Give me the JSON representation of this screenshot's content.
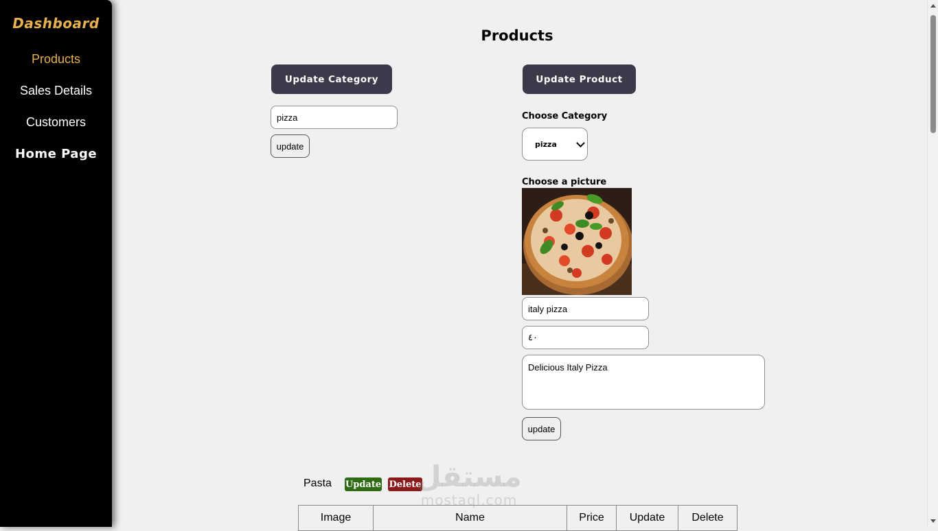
{
  "sidebar": {
    "brand": "Dashboard",
    "items": [
      {
        "label": "Products",
        "active": true
      },
      {
        "label": "Sales Details"
      },
      {
        "label": "Customers"
      },
      {
        "label": "Home Page"
      }
    ]
  },
  "page_title": "Products",
  "update_category": {
    "heading_button": "Update Category",
    "input_value": "pizza",
    "submit_label": "update"
  },
  "update_product": {
    "heading_button": "Update Product",
    "category_label": "Choose Category",
    "category_selected": "pizza",
    "picture_label": "Choose a picture",
    "name_value": "italy pizza",
    "price_value": "٤٠",
    "description_value": "Delicious Italy Pizza",
    "submit_label": "update"
  },
  "category_row": {
    "name": "Pasta",
    "update_label": "Update",
    "delete_label": "Delete"
  },
  "table": {
    "headers": [
      "Image",
      "Name",
      "Price",
      "Update",
      "Delete"
    ]
  },
  "watermark": {
    "arabic": "مستقل",
    "latin": "mostaql.com"
  },
  "colors": {
    "accent": "#e8b14f",
    "dark_button": "#3a3a4a",
    "update_tag": "#2e6b12",
    "delete_tag": "#8b1a1a"
  }
}
